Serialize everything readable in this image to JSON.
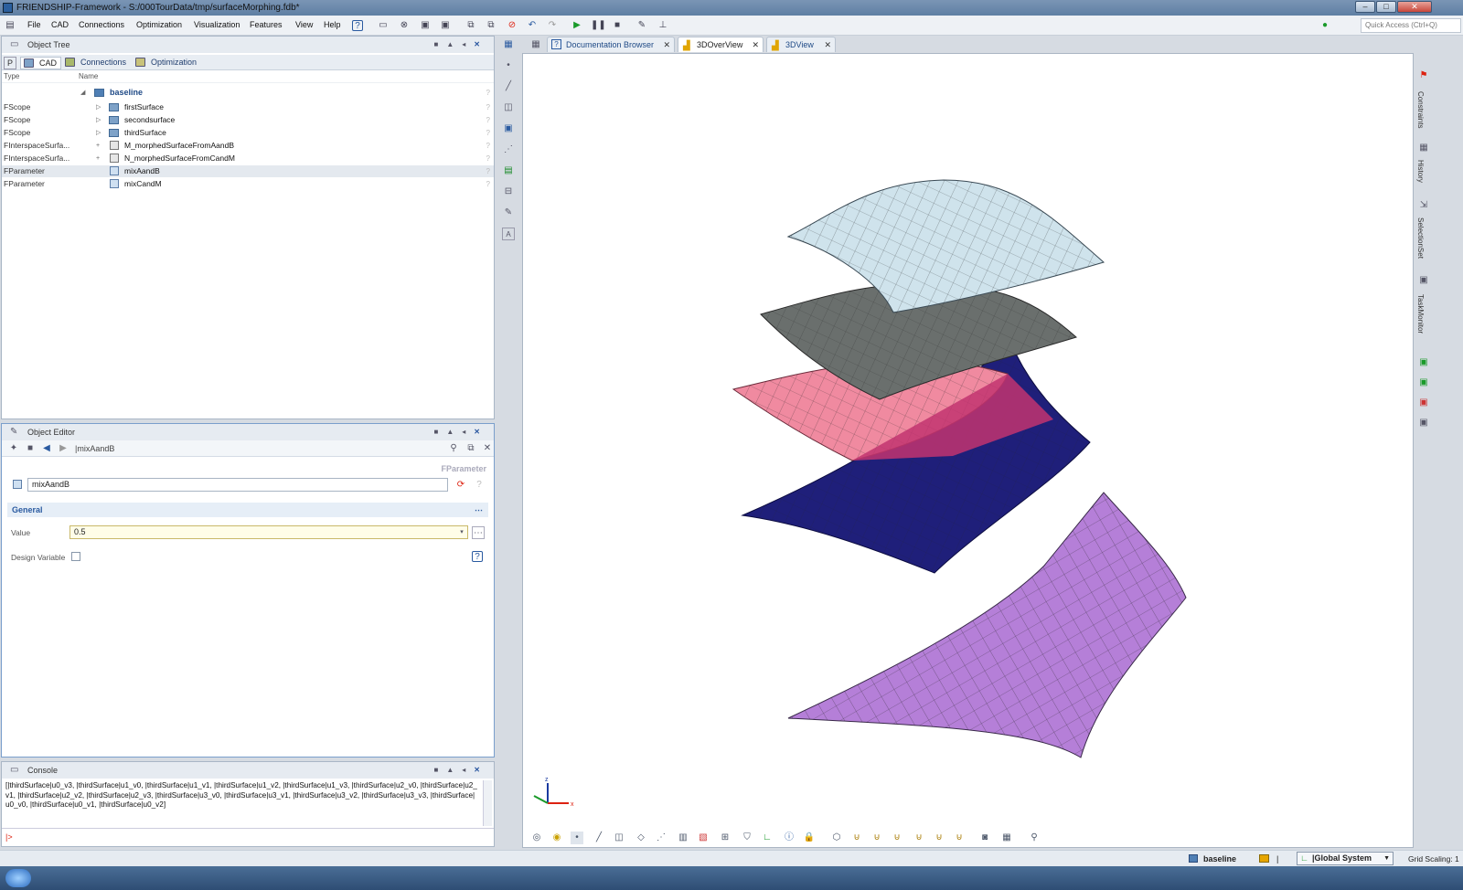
{
  "window": {
    "title": "FRIENDSHIP-Framework - S:/000TourData/tmp/surfaceMorphing.fdb*",
    "controls": [
      "–",
      "□",
      "✕"
    ]
  },
  "menu": {
    "items": [
      "File",
      "CAD",
      "Connections",
      "Optimization",
      "Visualization",
      "Features",
      "View",
      "Help"
    ],
    "quick_access": "Quick Access (Ctrl+Q)"
  },
  "object_tree": {
    "title": "Object Tree",
    "tabs": [
      "CAD",
      "Connections",
      "Optimization"
    ],
    "col_type": "Type",
    "col_name": "Name",
    "root": "baseline",
    "rows": [
      {
        "type": "FScope",
        "name": "firstSurface",
        "exp": "▷"
      },
      {
        "type": "FScope",
        "name": "secondsurface",
        "exp": "▷"
      },
      {
        "type": "FScope",
        "name": "thirdSurface",
        "exp": "▷"
      },
      {
        "type": "FInterspaceSurfa...",
        "name": "M_morphedSurfaceFromAandB",
        "exp": "+"
      },
      {
        "type": "FInterspaceSurfa...",
        "name": "N_morphedSurfaceFromCandM",
        "exp": "+"
      },
      {
        "type": "FParameter",
        "name": "mixAandB",
        "exp": ""
      },
      {
        "type": "FParameter",
        "name": "mixCandM",
        "exp": ""
      }
    ]
  },
  "object_editor": {
    "title": "Object Editor",
    "breadcrumb": "|mixAandB",
    "type_label": "FParameter",
    "name_value": "mixAandB",
    "section": "General",
    "value_label": "Value",
    "value": "0.5",
    "design_variable_label": "Design Variable"
  },
  "console": {
    "title": "Console",
    "output": "[|thirdSurface|u0_v3, |thirdSurface|u1_v0, |thirdSurface|u1_v1, |thirdSurface|u1_v2, |thirdSurface|u1_v3, |thirdSurface|u2_v0, |thirdSurface|u2_v1, |thirdSurface|u2_v2, |thirdSurface|u2_v3, |thirdSurface|u3_v0, |thirdSurface|u3_v1, |thirdSurface|u3_v2, |thirdSurface|u3_v3, |thirdSurface|u0_v0, |thirdSurface|u0_v1, |thirdSurface|u0_v2]",
    "prompt": "|>"
  },
  "view_tabs": [
    "Documentation Browser",
    "3DOverView",
    "3DView"
  ],
  "right_sidebar": [
    "Constraints",
    "History",
    "SelectionSet",
    "TaskMonitor"
  ],
  "status": {
    "scope": "baseline",
    "separator": "|",
    "coord_system": "|Global System",
    "grid_scaling": "Grid Scaling: 1"
  },
  "colors": {
    "surface1": "#cfe3ec",
    "surface2": "#6a6f6d",
    "surface3": "#f08aa0",
    "surface4": "#1f1f7a",
    "surface5": "#b57fd8",
    "accent": "#2a5aa0"
  }
}
